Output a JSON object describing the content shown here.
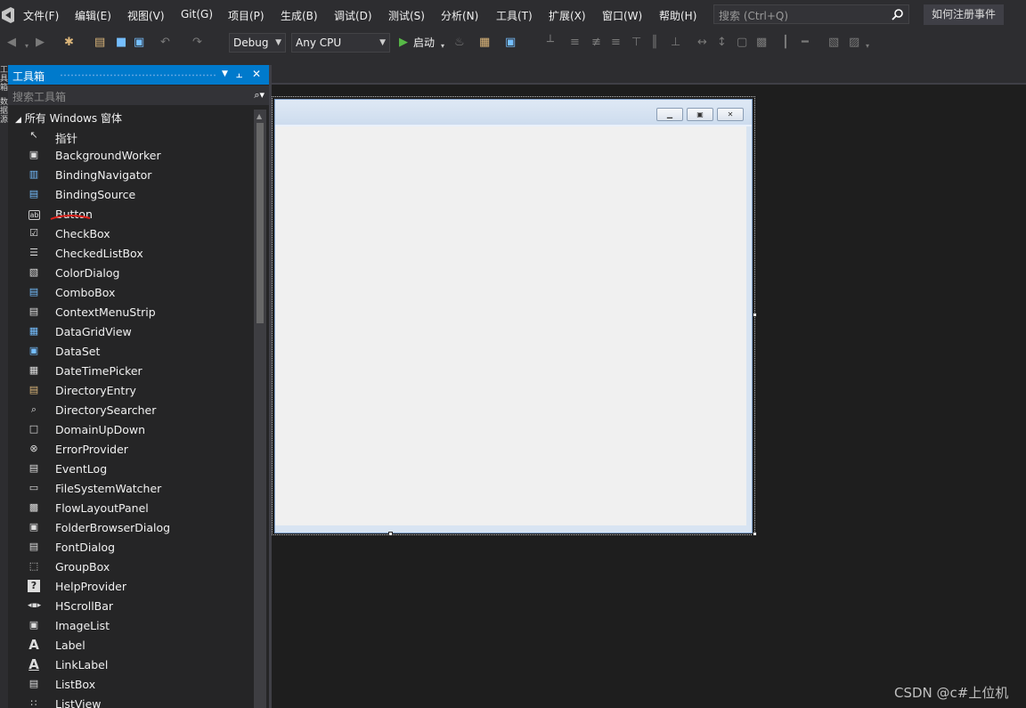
{
  "menubar": {
    "items": [
      "文件(F)",
      "编辑(E)",
      "视图(V)",
      "Git(G)",
      "项目(P)",
      "生成(B)",
      "调试(D)",
      "测试(S)",
      "分析(N)",
      "工具(T)",
      "扩展(X)",
      "窗口(W)",
      "帮助(H)"
    ],
    "search_placeholder": "搜索 (Ctrl+Q)",
    "event_button": "如何注册事件"
  },
  "toolbar": {
    "config": "Debug",
    "platform": "Any CPU",
    "start_label": "启动"
  },
  "side_tabs": [
    "工具箱",
    "数据源"
  ],
  "toolbox": {
    "title": "工具箱",
    "search_placeholder": "搜索工具箱",
    "group": "所有 Windows 窗体",
    "items": [
      {
        "label": "指针",
        "icon": "pointer-icon"
      },
      {
        "label": "BackgroundWorker",
        "icon": "background-worker-icon"
      },
      {
        "label": "BindingNavigator",
        "icon": "binding-navigator-icon"
      },
      {
        "label": "BindingSource",
        "icon": "binding-source-icon"
      },
      {
        "label": "Button",
        "icon": "button-icon"
      },
      {
        "label": "CheckBox",
        "icon": "checkbox-icon"
      },
      {
        "label": "CheckedListBox",
        "icon": "checked-listbox-icon"
      },
      {
        "label": "ColorDialog",
        "icon": "color-dialog-icon"
      },
      {
        "label": "ComboBox",
        "icon": "combobox-icon"
      },
      {
        "label": "ContextMenuStrip",
        "icon": "context-menu-icon"
      },
      {
        "label": "DataGridView",
        "icon": "datagrid-icon"
      },
      {
        "label": "DataSet",
        "icon": "dataset-icon"
      },
      {
        "label": "DateTimePicker",
        "icon": "datetime-icon"
      },
      {
        "label": "DirectoryEntry",
        "icon": "directory-entry-icon"
      },
      {
        "label": "DirectorySearcher",
        "icon": "directory-searcher-icon"
      },
      {
        "label": "DomainUpDown",
        "icon": "domain-updown-icon"
      },
      {
        "label": "ErrorProvider",
        "icon": "error-provider-icon"
      },
      {
        "label": "EventLog",
        "icon": "event-log-icon"
      },
      {
        "label": "FileSystemWatcher",
        "icon": "fs-watcher-icon"
      },
      {
        "label": "FlowLayoutPanel",
        "icon": "flow-layout-icon"
      },
      {
        "label": "FolderBrowserDialog",
        "icon": "folder-browser-icon"
      },
      {
        "label": "FontDialog",
        "icon": "font-dialog-icon"
      },
      {
        "label": "GroupBox",
        "icon": "groupbox-icon"
      },
      {
        "label": "HelpProvider",
        "icon": "help-provider-icon"
      },
      {
        "label": "HScrollBar",
        "icon": "hscrollbar-icon"
      },
      {
        "label": "ImageList",
        "icon": "imagelist-icon"
      },
      {
        "label": "Label",
        "icon": "label-icon"
      },
      {
        "label": "LinkLabel",
        "icon": "linklabel-icon"
      },
      {
        "label": "ListBox",
        "icon": "listbox-icon"
      },
      {
        "label": "ListView",
        "icon": "listview-icon"
      }
    ]
  },
  "watermark": "CSDN @c#上位机",
  "colors": {
    "accent": "#007acc",
    "background": "#1e1e1e",
    "panel": "#252526",
    "chrome": "#2d2d30",
    "annotation": "#e0201a"
  }
}
